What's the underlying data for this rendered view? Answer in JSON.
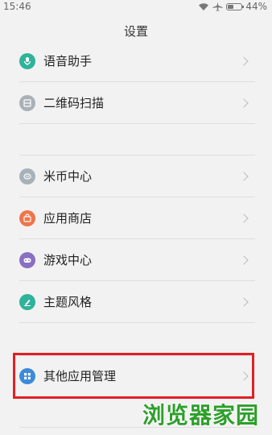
{
  "status_bar": {
    "time": "15:46",
    "battery_percent": "44%",
    "battery_level": 0.44
  },
  "header": {
    "title": "设置"
  },
  "items": [
    {
      "label": "语音助手",
      "icon": "microphone-icon",
      "color": "#2fb39a"
    },
    {
      "label": "二维码扫描",
      "icon": "qr-scan-icon",
      "color": "#a9b1b8"
    },
    {
      "label": "米币中心",
      "icon": "coin-icon",
      "color": "#a9b1b8"
    },
    {
      "label": "应用商店",
      "icon": "store-bag-icon",
      "color": "#ee7649"
    },
    {
      "label": "游戏中心",
      "icon": "gamepad-icon",
      "color": "#8a6fc2"
    },
    {
      "label": "主题风格",
      "icon": "brush-icon",
      "color": "#2fb39a"
    },
    {
      "label": "其他应用管理",
      "icon": "grid-apps-icon",
      "color": "#3c8bd9"
    }
  ],
  "highlight_color": "#e31e24",
  "watermark": {
    "text": "浏览器家园",
    "color": "#2d9f2a"
  }
}
